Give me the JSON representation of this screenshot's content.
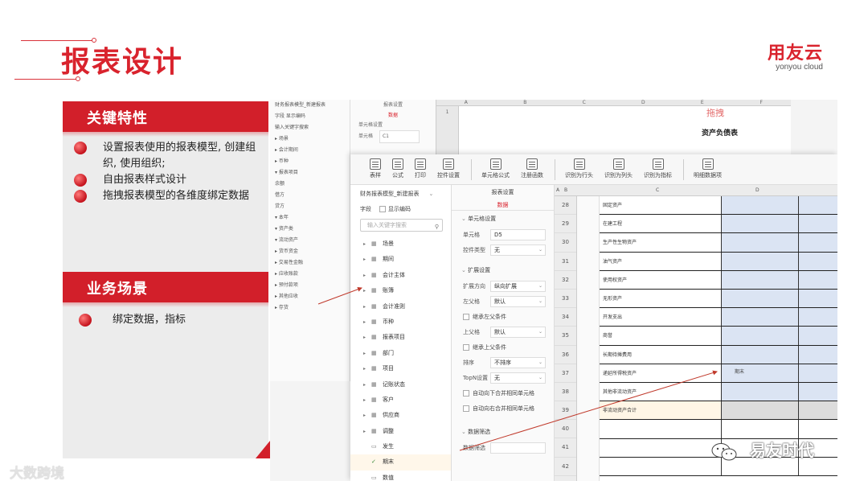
{
  "slide": {
    "title": "报表设计",
    "brand_main": "用友云",
    "brand_sub": "yonyou cloud"
  },
  "left_panel": {
    "sections": [
      {
        "heading": "关键特性",
        "bullets": [
          "设置报表使用的报表模型, 创建组织, 使用组织;",
          "自由报表样式设计",
          "拖拽报表模型的各维度绑定数据"
        ]
      },
      {
        "heading": "业务场景",
        "bullets": [
          "绑定数据，指标"
        ]
      }
    ]
  },
  "back_window": {
    "tree_rows": [
      "财务报表模型_新建报表",
      "字段  显示编码",
      "输入关键字搜索",
      "▸ 场景",
      "▸ 会计期间",
      "▸ 币种",
      "▾ 报表项目",
      "  余额",
      "  借方",
      "  贷方",
      "▾ 本年",
      "  ▾ 资产类",
      "    ▾ 流动资产",
      "      ▸ 货币资金",
      "      ▸ 交易性金融",
      "      ▸ 应收账款",
      "      ▸ 预付款项",
      "      ▸ 其他应收",
      "      ▸ 存货"
    ],
    "prop_title": "报表设置",
    "prop_tab": "数据",
    "prop_section": "单元格设置",
    "prop_cell_label": "单元格",
    "prop_cell_value": "C1",
    "columns": [
      "A",
      "B",
      "C",
      "D",
      "E",
      "F"
    ],
    "drag_label": "拖拽",
    "caption": "资产负债表"
  },
  "toolbar": {
    "buttons": [
      {
        "label": "表样",
        "icon": "table-icon"
      },
      {
        "label": "公式",
        "icon": "sigma-icon"
      },
      {
        "label": "打印",
        "icon": "printer-icon"
      },
      {
        "label": "控件设置",
        "icon": "gear-icon"
      },
      {
        "label": "单元格公式",
        "icon": "fx-icon"
      },
      {
        "label": "注册函数",
        "icon": "function-icon"
      },
      {
        "label": "识别为行头",
        "icon": "grid-icon"
      },
      {
        "label": "识别为列头",
        "icon": "grid-icon"
      },
      {
        "label": "识别为指标",
        "icon": "grid-icon"
      },
      {
        "label": "明细数据项",
        "icon": "fx-icon"
      }
    ]
  },
  "tree": {
    "model": "财务报表模型_新建报表",
    "tab_field": "字段",
    "tab_show_code": "显示编码",
    "search_placeholder": "输入关键字搜索",
    "nodes": [
      {
        "label": "场景",
        "icon": "▦",
        "expand": "▸"
      },
      {
        "label": "期间",
        "icon": "▦",
        "expand": "▸"
      },
      {
        "label": "会计主体",
        "icon": "▦",
        "expand": "▸"
      },
      {
        "label": "账簿",
        "icon": "▦",
        "expand": "▸"
      },
      {
        "label": "会计准则",
        "icon": "▦",
        "expand": "▸"
      },
      {
        "label": "币种",
        "icon": "▦",
        "expand": "▸"
      },
      {
        "label": "报表项目",
        "icon": "▦",
        "expand": "▸"
      },
      {
        "label": "部门",
        "icon": "▦",
        "expand": "▸"
      },
      {
        "label": "项目",
        "icon": "▦",
        "expand": "▸"
      },
      {
        "label": "记账状态",
        "icon": "▦",
        "expand": "▸"
      },
      {
        "label": "客户",
        "icon": "▦",
        "expand": "▸"
      },
      {
        "label": "供应商",
        "icon": "▦",
        "expand": "▸"
      },
      {
        "label": "调整",
        "icon": "▦",
        "expand": "▸"
      },
      {
        "label": "发生",
        "icon": "▭",
        "expand": ""
      },
      {
        "label": "期末",
        "icon": "✓",
        "expand": "",
        "active": true
      },
      {
        "label": "数值",
        "icon": "▭",
        "expand": ""
      }
    ]
  },
  "props": {
    "title": "报表设置",
    "tab": "数据",
    "cell_section": "单元格设置",
    "cell_label": "单元格",
    "cell_value": "D5",
    "control_label": "控件类型",
    "control_value": "无",
    "expand_section": "扩展设置",
    "expand_dir_label": "扩展方向",
    "expand_dir_value": "纵向扩展",
    "left_parent_label": "左父格",
    "left_parent_value": "默认",
    "inherit_left": "继承左父条件",
    "up_parent_label": "上父格",
    "up_parent_value": "默认",
    "inherit_up": "继承上父条件",
    "sort_label": "排序",
    "sort_value": "不排序",
    "topn_label": "TopN设置",
    "topn_value": "无",
    "merge_v": "自动向下合并相同单元格",
    "merge_h": "自动向右合并相同单元格",
    "data_section": "数据筛选",
    "data_filter_label": "数据筛选"
  },
  "sheet": {
    "columns": [
      "A",
      "B",
      "C",
      "D"
    ],
    "rows": [
      {
        "num": "28",
        "label": "固定资产"
      },
      {
        "num": "29",
        "label": "在建工程"
      },
      {
        "num": "30",
        "label": "生产性生物资产"
      },
      {
        "num": "31",
        "label": "油气资产"
      },
      {
        "num": "32",
        "label": "使用权资产"
      },
      {
        "num": "33",
        "label": "无形资产"
      },
      {
        "num": "34",
        "label": "开发支出"
      },
      {
        "num": "35",
        "label": "商誉"
      },
      {
        "num": "36",
        "label": "长期待摊费用"
      },
      {
        "num": "37",
        "label": "递延所得税资产"
      },
      {
        "num": "38",
        "label": "其他非流动资产"
      },
      {
        "num": "39",
        "label": "非流动资产合计"
      },
      {
        "num": "40",
        "label": ""
      },
      {
        "num": "41",
        "label": ""
      },
      {
        "num": "42",
        "label": ""
      }
    ],
    "drop_value": "期末"
  },
  "watermarks": {
    "left": "大数跨境",
    "right": "易友时代"
  },
  "colors": {
    "accent": "#d9232d",
    "cell_blue": "#dbe4f3",
    "panel_gray": "#ececec"
  }
}
